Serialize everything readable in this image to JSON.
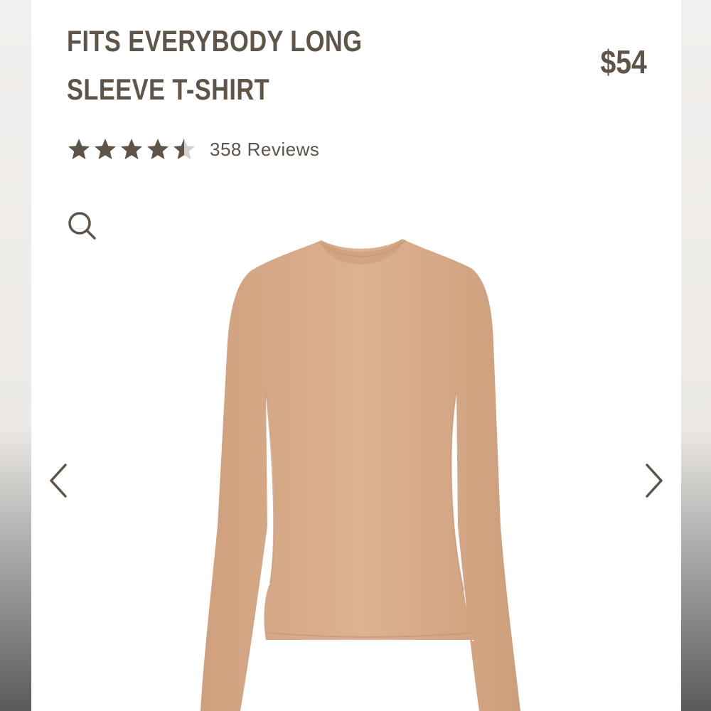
{
  "product": {
    "title": "FITS EVERYBODY LONG SLEEVE T-SHIRT",
    "price": "$54",
    "rating": {
      "value": 4.5,
      "max": 5,
      "reviews_label": "358 Reviews"
    }
  },
  "gallery": {
    "zoom_icon": "search-icon",
    "prev_icon": "chevron-left-icon",
    "next_icon": "chevron-right-icon",
    "garment_color": "#d9ae8c"
  },
  "colors": {
    "text": "#5e5449",
    "star_filled": "#5e5449",
    "star_empty": "#d4d0cc"
  }
}
